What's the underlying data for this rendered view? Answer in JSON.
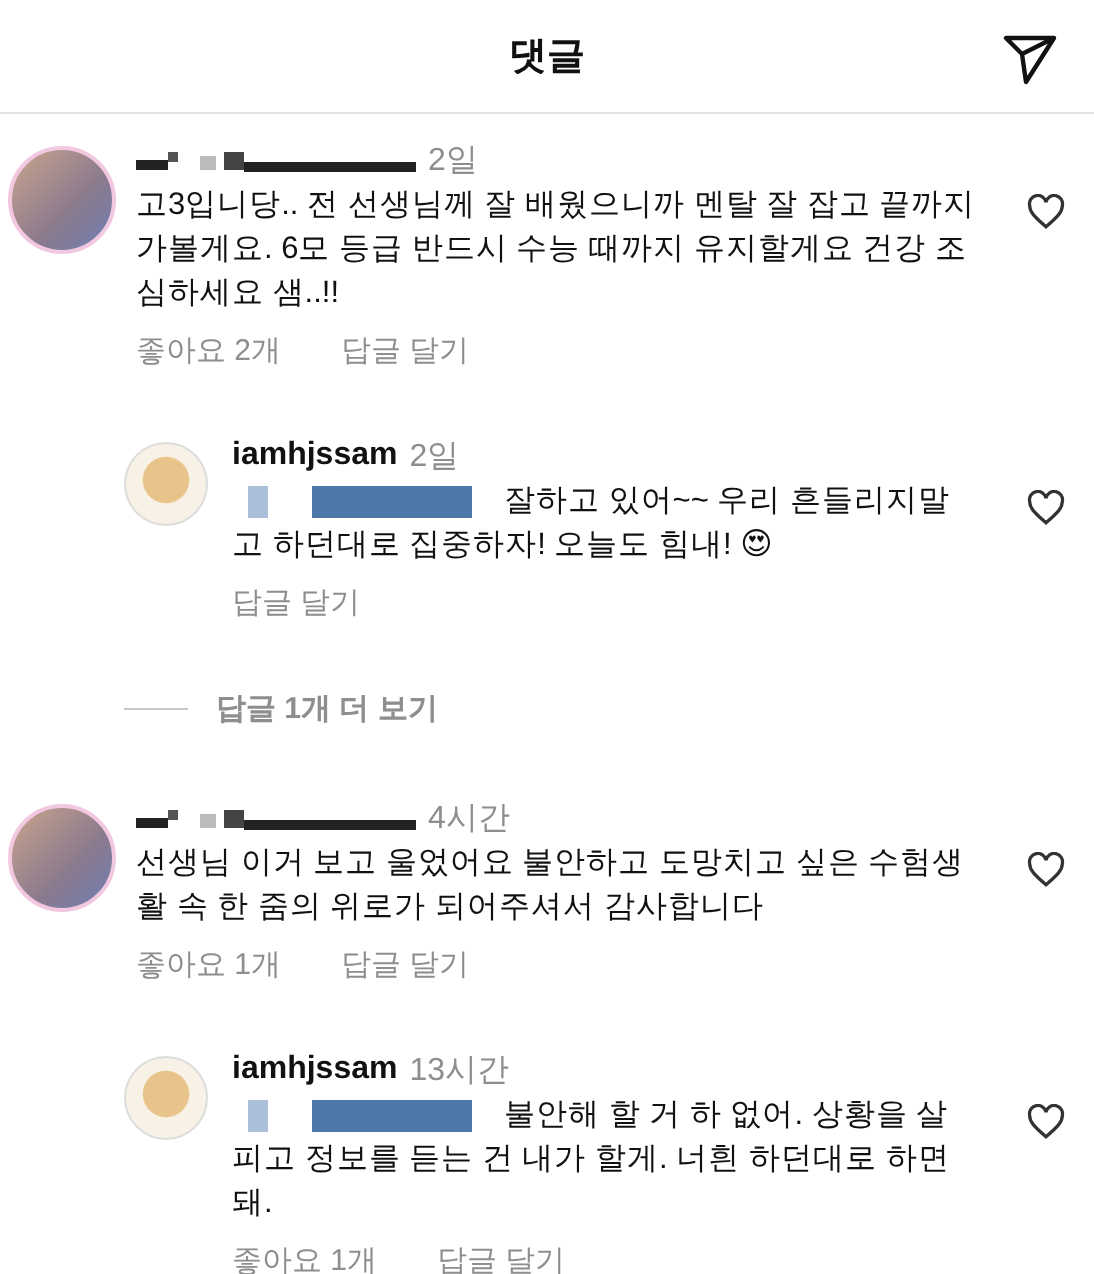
{
  "header": {
    "title": "댓글"
  },
  "items": [
    {
      "kind": "comment",
      "time": "2일",
      "text": "고3입니당.. 전 선생님께 잘 배웠으니까 멘탈 잘 잡고 끝까지 가볼게요. 6모 등급 반드시 수능 때까지 유지할게요 건강 조심하세요 샘..!!",
      "likes": "좋아요 2개",
      "reply": "답글 달기"
    },
    {
      "kind": "reply",
      "user": "iamhjssam",
      "time": "2일",
      "text": "잘하고 있어~~ 우리 흔들리지말고 하던대로 집중하자! 오늘도 힘내! 😍",
      "reply": "답글 달기"
    },
    {
      "kind": "more",
      "text": "답글 1개 더 보기"
    },
    {
      "kind": "comment",
      "time": "4시간",
      "text": "선생님 이거 보고 울었어요 불안하고 도망치고 싶은 수험생활 속 한 줌의 위로가 되어주셔서 감사합니다",
      "likes": "좋아요 1개",
      "reply": "답글 달기"
    },
    {
      "kind": "reply",
      "user": "iamhjssam",
      "time": "13시간",
      "text": "불안해 할 거 하 없어. 상황을 살피고 정보를 듣는 건 내가 할게. 너흰 하던대로 하면 돼.",
      "likes": "좋아요 1개",
      "reply": "답글 달기"
    }
  ]
}
